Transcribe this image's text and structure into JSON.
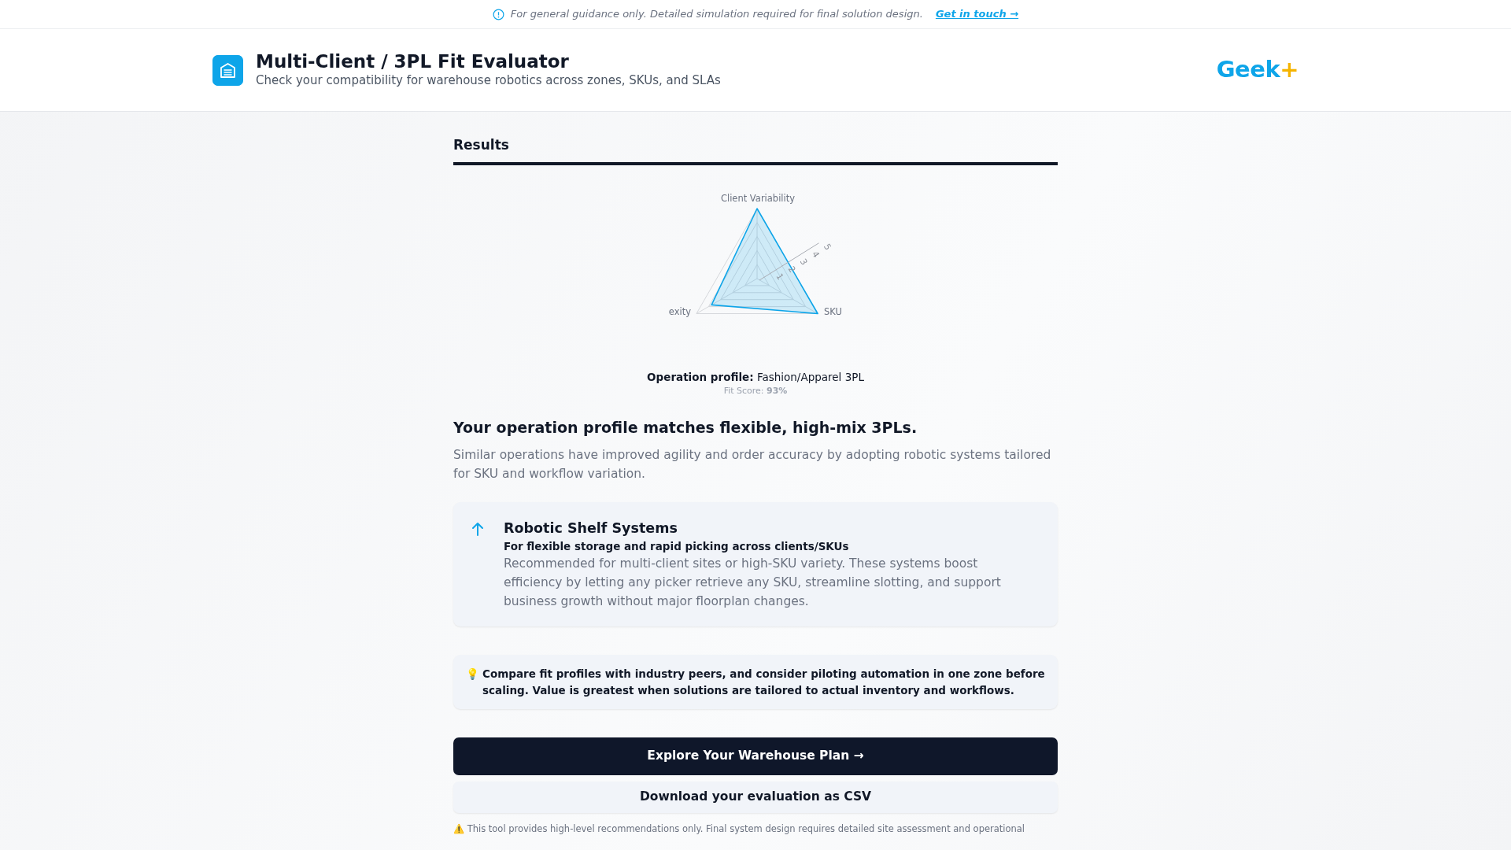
{
  "notice": {
    "text": "For general guidance only. Detailed simulation required for final solution design.",
    "link": "Get in touch →"
  },
  "header": {
    "title": "Multi-Client / 3PL Fit Evaluator",
    "subtitle": "Check your compatibility for warehouse robotics across zones, SKUs, and SLAs",
    "logo": {
      "word": "Geek",
      "mark": "+"
    }
  },
  "results": {
    "heading": "Results",
    "radar": {
      "axes": [
        {
          "label": "Client Variability"
        },
        {
          "label": "SKU"
        },
        {
          "label": "exity"
        }
      ],
      "ticks": [
        "1",
        "2",
        "3",
        "4",
        "5"
      ]
    },
    "profile": {
      "label": "Operation profile:",
      "value": "Fashion/Apparel 3PL"
    },
    "fit_score": {
      "label": "Fit Score:",
      "value": "93%"
    },
    "summary_title": "Your operation profile matches flexible, high-mix 3PLs.",
    "summary_text": "Similar operations have improved agility and order accuracy by adopting robotic systems tailored for SKU and workflow variation.",
    "recommendation": {
      "title": "Robotic Shelf Systems",
      "subtitle": "For flexible storage and rapid picking across clients/SKUs",
      "text": "Recommended for multi-client sites or high-SKU variety. These systems boost efficiency by letting any picker retrieve any SKU, streamline slotting, and support business growth without major floorplan changes."
    },
    "tip": {
      "icon": "💡",
      "text": "Compare fit profiles with industry peers, and consider piloting automation in one zone before scaling. Value is greatest when solutions are tailored to actual inventory and workflows."
    },
    "buttons": [
      {
        "label": "Explore Your Warehouse Plan →",
        "kind": "primary"
      },
      {
        "label": "Download your evaluation as CSV",
        "kind": "secondary"
      }
    ],
    "disclaimer": {
      "icon": "⚠️",
      "text": "This tool provides high-level recommendations only. Final system design requires detailed site assessment and operational"
    }
  }
}
